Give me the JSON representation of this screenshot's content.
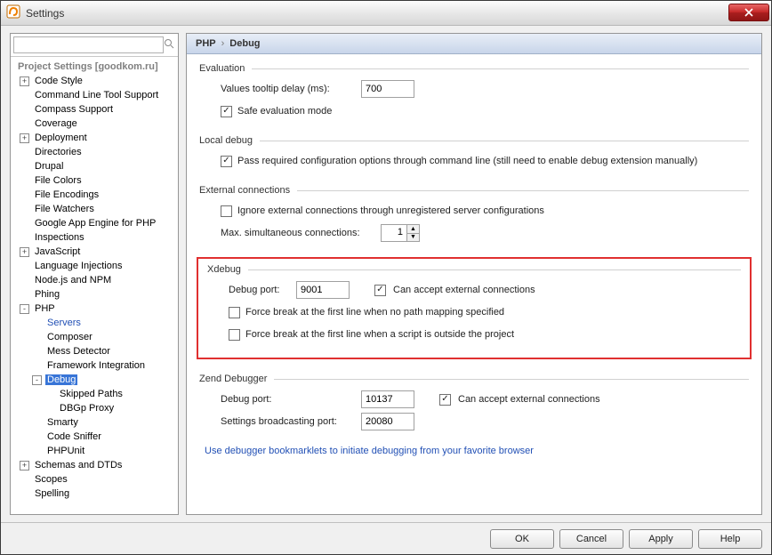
{
  "window": {
    "title": "Settings"
  },
  "sidebar": {
    "header": "Project Settings [goodkom.ru]",
    "nodes": [
      {
        "label": "Code Style",
        "depth": 1,
        "exp": "+"
      },
      {
        "label": "Command Line Tool Support",
        "depth": 1,
        "exp": ""
      },
      {
        "label": "Compass Support",
        "depth": 1,
        "exp": ""
      },
      {
        "label": "Coverage",
        "depth": 1,
        "exp": ""
      },
      {
        "label": "Deployment",
        "depth": 1,
        "exp": "+"
      },
      {
        "label": "Directories",
        "depth": 1,
        "exp": ""
      },
      {
        "label": "Drupal",
        "depth": 1,
        "exp": ""
      },
      {
        "label": "File Colors",
        "depth": 1,
        "exp": ""
      },
      {
        "label": "File Encodings",
        "depth": 1,
        "exp": ""
      },
      {
        "label": "File Watchers",
        "depth": 1,
        "exp": ""
      },
      {
        "label": "Google App Engine for PHP",
        "depth": 1,
        "exp": ""
      },
      {
        "label": "Inspections",
        "depth": 1,
        "exp": ""
      },
      {
        "label": "JavaScript",
        "depth": 1,
        "exp": "+"
      },
      {
        "label": "Language Injections",
        "depth": 1,
        "exp": ""
      },
      {
        "label": "Node.js and NPM",
        "depth": 1,
        "exp": ""
      },
      {
        "label": "Phing",
        "depth": 1,
        "exp": ""
      },
      {
        "label": "PHP",
        "depth": 1,
        "exp": "-"
      },
      {
        "label": "Servers",
        "depth": 2,
        "exp": "",
        "link": true
      },
      {
        "label": "Composer",
        "depth": 2,
        "exp": ""
      },
      {
        "label": "Mess Detector",
        "depth": 2,
        "exp": ""
      },
      {
        "label": "Framework Integration",
        "depth": 2,
        "exp": ""
      },
      {
        "label": "Debug",
        "depth": 2,
        "exp": "-",
        "sel": true
      },
      {
        "label": "Skipped Paths",
        "depth": 3,
        "exp": ""
      },
      {
        "label": "DBGp Proxy",
        "depth": 3,
        "exp": ""
      },
      {
        "label": "Smarty",
        "depth": 2,
        "exp": ""
      },
      {
        "label": "Code Sniffer",
        "depth": 2,
        "exp": ""
      },
      {
        "label": "PHPUnit",
        "depth": 2,
        "exp": ""
      },
      {
        "label": "Schemas and DTDs",
        "depth": 1,
        "exp": "+"
      },
      {
        "label": "Scopes",
        "depth": 1,
        "exp": ""
      },
      {
        "label": "Spelling",
        "depth": 1,
        "exp": ""
      }
    ]
  },
  "breadcrumb": {
    "root": "PHP",
    "sep": "›",
    "leaf": "Debug"
  },
  "evaluation": {
    "title": "Evaluation",
    "tooltip_label": "Values tooltip delay (ms):",
    "tooltip_value": "700",
    "safe_label": "Safe evaluation mode",
    "safe_checked": true
  },
  "local_debug": {
    "title": "Local debug",
    "pass_label": "Pass required configuration options through command line (still need to enable debug extension manually)",
    "pass_checked": true
  },
  "external": {
    "title": "External connections",
    "ignore_label": "Ignore external connections through unregistered server configurations",
    "ignore_checked": false,
    "max_label": "Max. simultaneous connections:",
    "max_value": "1"
  },
  "xdebug": {
    "title": "Xdebug",
    "port_label": "Debug port:",
    "port_value": "9001",
    "accept_label": "Can accept external connections",
    "accept_checked": true,
    "break1_label": "Force break at the first line when no path mapping specified",
    "break1_checked": false,
    "break2_label": "Force break at the first line when a script is outside the project",
    "break2_checked": false
  },
  "zend": {
    "title": "Zend Debugger",
    "port_label": "Debug port:",
    "port_value": "10137",
    "accept_label": "Can accept external connections",
    "accept_checked": true,
    "broadcast_label": "Settings broadcasting port:",
    "broadcast_value": "20080"
  },
  "linkline": "Use debugger bookmarklets to initiate debugging from your favorite browser",
  "buttons": {
    "ok": "OK",
    "cancel": "Cancel",
    "apply": "Apply",
    "help": "Help"
  }
}
